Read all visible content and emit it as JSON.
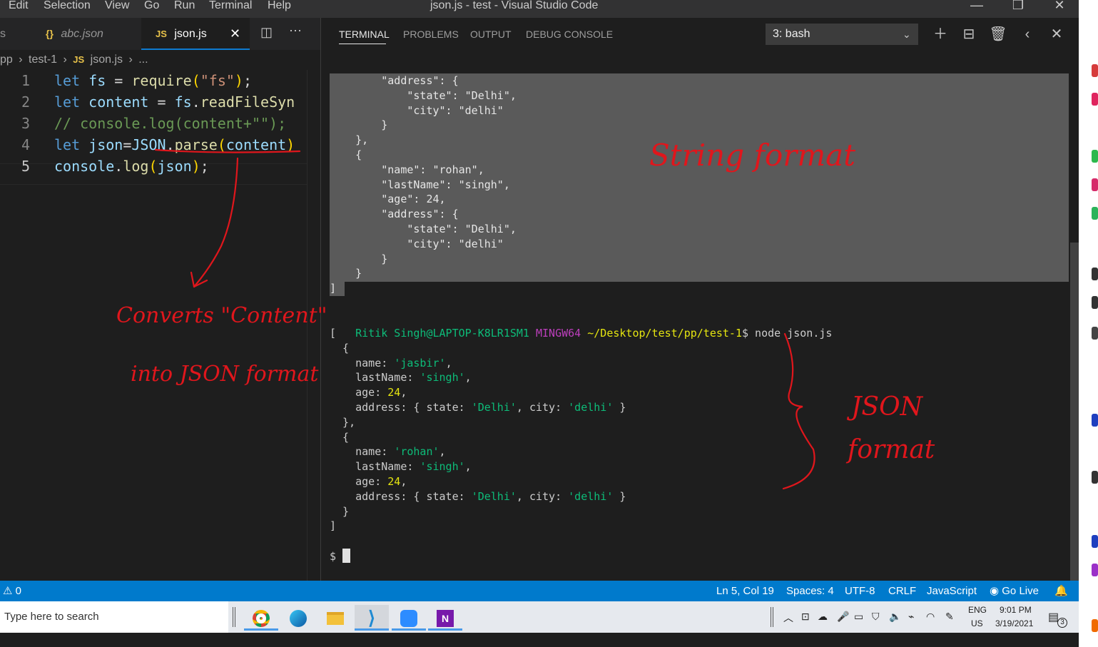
{
  "titlebar": {
    "menu": [
      "Edit",
      "Selection",
      "View",
      "Go",
      "Run",
      "Terminal",
      "Help"
    ],
    "title": "json.js - test - Visual Studio Code"
  },
  "tabs": [
    {
      "label": "abc.json",
      "icon": "{}"
    },
    {
      "label": "json.js",
      "icon": "JS"
    }
  ],
  "breadcrumb": {
    "items": [
      "pp",
      "test-1",
      "json.js",
      "..."
    ],
    "file_icon": "JS"
  },
  "editor": {
    "line_numbers": [
      "1",
      "2",
      "3",
      "4",
      "5"
    ],
    "lines": [
      [
        {
          "t": "let",
          "c": "kw"
        },
        {
          "t": " ",
          "c": "pl"
        },
        {
          "t": "fs",
          "c": "var"
        },
        {
          "t": " = ",
          "c": "pl"
        },
        {
          "t": "require",
          "c": "fn"
        },
        {
          "t": "(",
          "c": "br"
        },
        {
          "t": "\"fs\"",
          "c": "str"
        },
        {
          "t": ")",
          "c": "br"
        },
        {
          "t": ";",
          "c": "pl"
        }
      ],
      [
        {
          "t": "let",
          "c": "kw"
        },
        {
          "t": " ",
          "c": "pl"
        },
        {
          "t": "content",
          "c": "var"
        },
        {
          "t": " = ",
          "c": "pl"
        },
        {
          "t": "fs",
          "c": "var"
        },
        {
          "t": ".",
          "c": "pl"
        },
        {
          "t": "readFileSyn",
          "c": "fn"
        }
      ],
      [
        {
          "t": "// console.log(content+\"\");",
          "c": "cmt"
        }
      ],
      [
        {
          "t": "let",
          "c": "kw"
        },
        {
          "t": " ",
          "c": "pl"
        },
        {
          "t": "json",
          "c": "var"
        },
        {
          "t": "=",
          "c": "pl"
        },
        {
          "t": "JSON",
          "c": "var"
        },
        {
          "t": ".",
          "c": "pl"
        },
        {
          "t": "parse",
          "c": "fn"
        },
        {
          "t": "(",
          "c": "br"
        },
        {
          "t": "content",
          "c": "var"
        },
        {
          "t": ")",
          "c": "br"
        }
      ],
      [
        {
          "t": "console",
          "c": "var"
        },
        {
          "t": ".",
          "c": "pl"
        },
        {
          "t": "log",
          "c": "fn"
        },
        {
          "t": "(",
          "c": "br"
        },
        {
          "t": "json",
          "c": "var"
        },
        {
          "t": ")",
          "c": "br"
        },
        {
          "t": ";",
          "c": "pl"
        }
      ]
    ]
  },
  "panel": {
    "tabs": [
      "TERMINAL",
      "PROBLEMS",
      "OUTPUT",
      "DEBUG CONSOLE"
    ],
    "terminal_selected": "3: bash"
  },
  "terminal": {
    "selected_lines": [
      "        \"address\": {",
      "            \"state\": \"Delhi\",",
      "            \"city\": \"delhi\"",
      "        }",
      "    },",
      "    {",
      "        \"name\": \"rohan\",",
      "        \"lastName\": \"singh\",",
      "        \"age\": 24,",
      "        \"address\": {",
      "            \"state\": \"Delhi\",",
      "            \"city\": \"delhi\"",
      "        }",
      "    }",
      "]"
    ],
    "prompt_user": "Ritik Singh@LAPTOP-K8LR1SM1",
    "prompt_env": "MINGW64",
    "prompt_path": "~/Desktop/test/pp/test-1",
    "command": "$ node json.js",
    "output": [
      [
        {
          "t": "[",
          "c": ""
        }
      ],
      [
        {
          "t": "  {",
          "c": ""
        }
      ],
      [
        {
          "t": "    name: ",
          "c": ""
        },
        {
          "t": "'jasbir'",
          "c": "tgreen"
        },
        {
          "t": ",",
          "c": ""
        }
      ],
      [
        {
          "t": "    lastName: ",
          "c": ""
        },
        {
          "t": "'singh'",
          "c": "tgreen"
        },
        {
          "t": ",",
          "c": ""
        }
      ],
      [
        {
          "t": "    age: ",
          "c": ""
        },
        {
          "t": "24",
          "c": "tnum"
        },
        {
          "t": ",",
          "c": ""
        }
      ],
      [
        {
          "t": "    address: { state: ",
          "c": ""
        },
        {
          "t": "'Delhi'",
          "c": "tgreen"
        },
        {
          "t": ", city: ",
          "c": ""
        },
        {
          "t": "'delhi'",
          "c": "tgreen"
        },
        {
          "t": " }",
          "c": ""
        }
      ],
      [
        {
          "t": "  },",
          "c": ""
        }
      ],
      [
        {
          "t": "  {",
          "c": ""
        }
      ],
      [
        {
          "t": "    name: ",
          "c": ""
        },
        {
          "t": "'rohan'",
          "c": "tgreen"
        },
        {
          "t": ",",
          "c": ""
        }
      ],
      [
        {
          "t": "    lastName: ",
          "c": ""
        },
        {
          "t": "'singh'",
          "c": "tgreen"
        },
        {
          "t": ",",
          "c": ""
        }
      ],
      [
        {
          "t": "    age: ",
          "c": ""
        },
        {
          "t": "24",
          "c": "tnum"
        },
        {
          "t": ",",
          "c": ""
        }
      ],
      [
        {
          "t": "    address: { state: ",
          "c": ""
        },
        {
          "t": "'Delhi'",
          "c": "tgreen"
        },
        {
          "t": ", city: ",
          "c": ""
        },
        {
          "t": "'delhi'",
          "c": "tgreen"
        },
        {
          "t": " }",
          "c": ""
        }
      ],
      [
        {
          "t": "  }",
          "c": ""
        }
      ],
      [
        {
          "t": "]",
          "c": ""
        }
      ]
    ],
    "final_prompt": "$"
  },
  "statusbar": {
    "warnings": "0",
    "position": "Ln 5, Col 19",
    "spaces": "Spaces: 4",
    "encoding": "UTF-8",
    "eol": "CRLF",
    "language": "JavaScript",
    "golive": "Go Live"
  },
  "taskbar": {
    "search_placeholder": "Type here to search",
    "lang_top": "ENG",
    "lang_bottom": "US",
    "time": "9:01 PM",
    "date": "3/19/2021",
    "notif_count": "3"
  },
  "annotations": {
    "converts_line1": "Converts \"Content\"",
    "converts_line2": "into JSON format",
    "string_format": "String format",
    "json_line1": "JSON",
    "json_line2": "format"
  },
  "colors": {
    "accent": "#007acc",
    "annotation": "#e0161c",
    "terminal_green": "#0dbc79",
    "terminal_yellow": "#e5e510"
  }
}
